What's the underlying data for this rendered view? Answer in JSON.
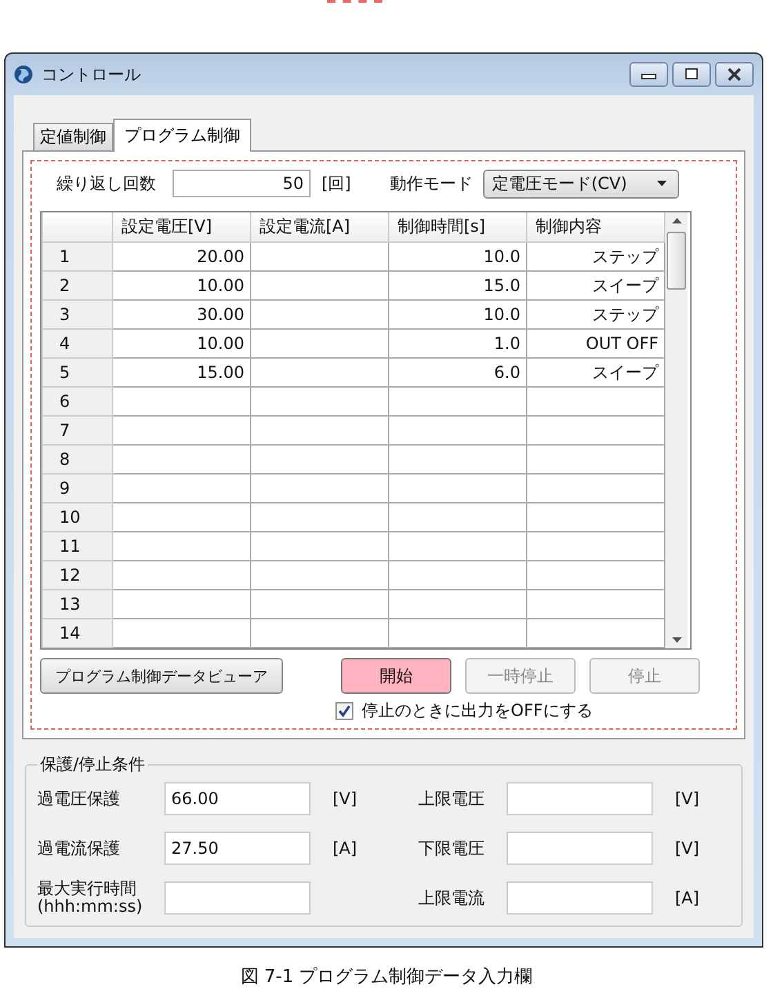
{
  "window": {
    "title": "コントロール"
  },
  "tabs": [
    {
      "label": "定値制御",
      "selected": false
    },
    {
      "label": "プログラム制御",
      "selected": true
    }
  ],
  "repeat": {
    "label": "繰り返し回数",
    "value": "50",
    "unit": "[回]"
  },
  "mode": {
    "label": "動作モード",
    "value": "定電圧モード(CV)"
  },
  "table": {
    "columns": [
      "設定電圧[V]",
      "設定電流[A]",
      "制御時間[s]",
      "制御内容"
    ],
    "rows": [
      {
        "no": "1",
        "cells": [
          "20.00",
          null,
          "10.0",
          "ステップ"
        ]
      },
      {
        "no": "2",
        "cells": [
          "10.00",
          null,
          "15.0",
          "スイープ"
        ]
      },
      {
        "no": "3",
        "cells": [
          "30.00",
          null,
          "10.0",
          "ステップ"
        ]
      },
      {
        "no": "4",
        "cells": [
          "10.00",
          null,
          "1.0",
          "OUT OFF"
        ]
      },
      {
        "no": "5",
        "cells": [
          "15.00",
          null,
          "6.0",
          "スイープ"
        ]
      },
      {
        "no": "6"
      },
      {
        "no": "7"
      },
      {
        "no": "8"
      },
      {
        "no": "9"
      },
      {
        "no": "10"
      },
      {
        "no": "11"
      },
      {
        "no": "12"
      },
      {
        "no": "13"
      },
      {
        "no": "14"
      }
    ]
  },
  "viewer_button": "プログラム制御データビューア",
  "run_buttons": [
    {
      "label": "開始",
      "active": true,
      "disabled": false
    },
    {
      "label": "一時停止",
      "active": false,
      "disabled": true
    },
    {
      "label": "停止",
      "active": false,
      "disabled": true
    }
  ],
  "output_off": {
    "label": "停止のときに出力をOFFにする",
    "checked": true
  },
  "protection": {
    "title": "保護/停止条件",
    "left": [
      {
        "label": "過電圧保護",
        "value": "66.00",
        "unit": "[V]"
      },
      {
        "label": "過電流保護",
        "value": "27.50",
        "unit": "[A]"
      },
      {
        "label": "最大実行時間\n(hhh:mm:ss)"
      }
    ],
    "right": [
      {
        "label": "上限電圧",
        "unit": "[V]"
      },
      {
        "label": "下限電圧",
        "unit": "[V]"
      },
      {
        "label": "上限電流",
        "unit": "[A]"
      }
    ]
  },
  "caption": "図 7-1 プログラム制御データ入力欄"
}
